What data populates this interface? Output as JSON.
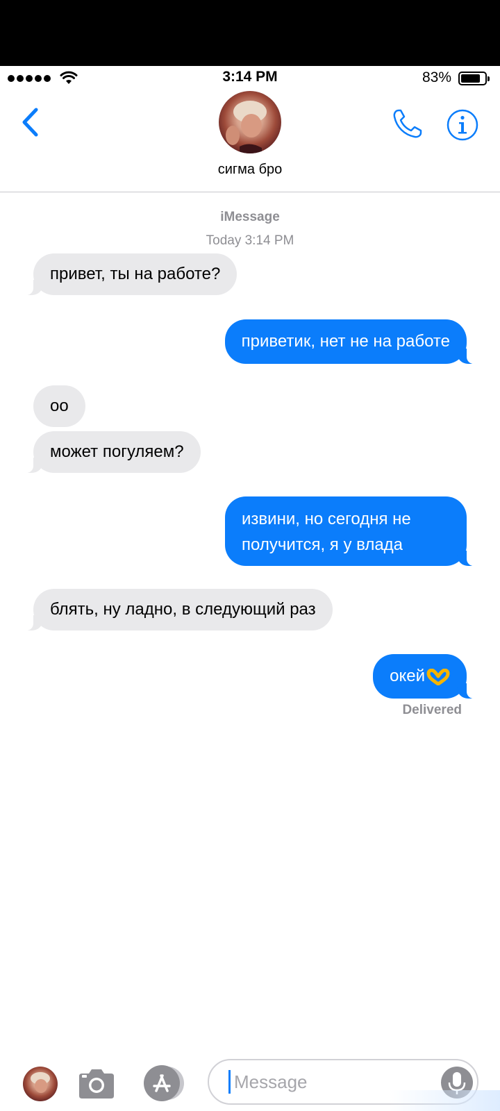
{
  "status_bar": {
    "time": "3:14 PM",
    "battery_percent": "83%",
    "battery_level": 0.83
  },
  "header": {
    "contact_name": "сигма бро",
    "icons": [
      "chevron-left-icon",
      "phone-icon",
      "info-icon"
    ]
  },
  "conversation": {
    "service": "iMessage",
    "timestamp": "Today 3:14 PM",
    "messages": [
      {
        "from": "them",
        "text": "привет, ты на работе?"
      },
      {
        "from": "me",
        "text": "приветик, нет не на работе"
      },
      {
        "from": "them",
        "text": "оо"
      },
      {
        "from": "them",
        "text": "может погуляем?"
      },
      {
        "from": "me",
        "text": "извини, но сегодня не получится, я у влада"
      },
      {
        "from": "them",
        "text": "блять, ну ладно, в следующий раз"
      },
      {
        "from": "me",
        "text": "окей"
      }
    ],
    "delivery_status": "Delivered"
  },
  "input_bar": {
    "placeholder": "Message",
    "icons": [
      "camera-icon",
      "app-store-icon",
      "microphone-icon"
    ]
  },
  "colors": {
    "accent": "#0b7dfb",
    "incoming_bubble": "#e9e9eb",
    "secondary_text": "#8e8e93"
  }
}
